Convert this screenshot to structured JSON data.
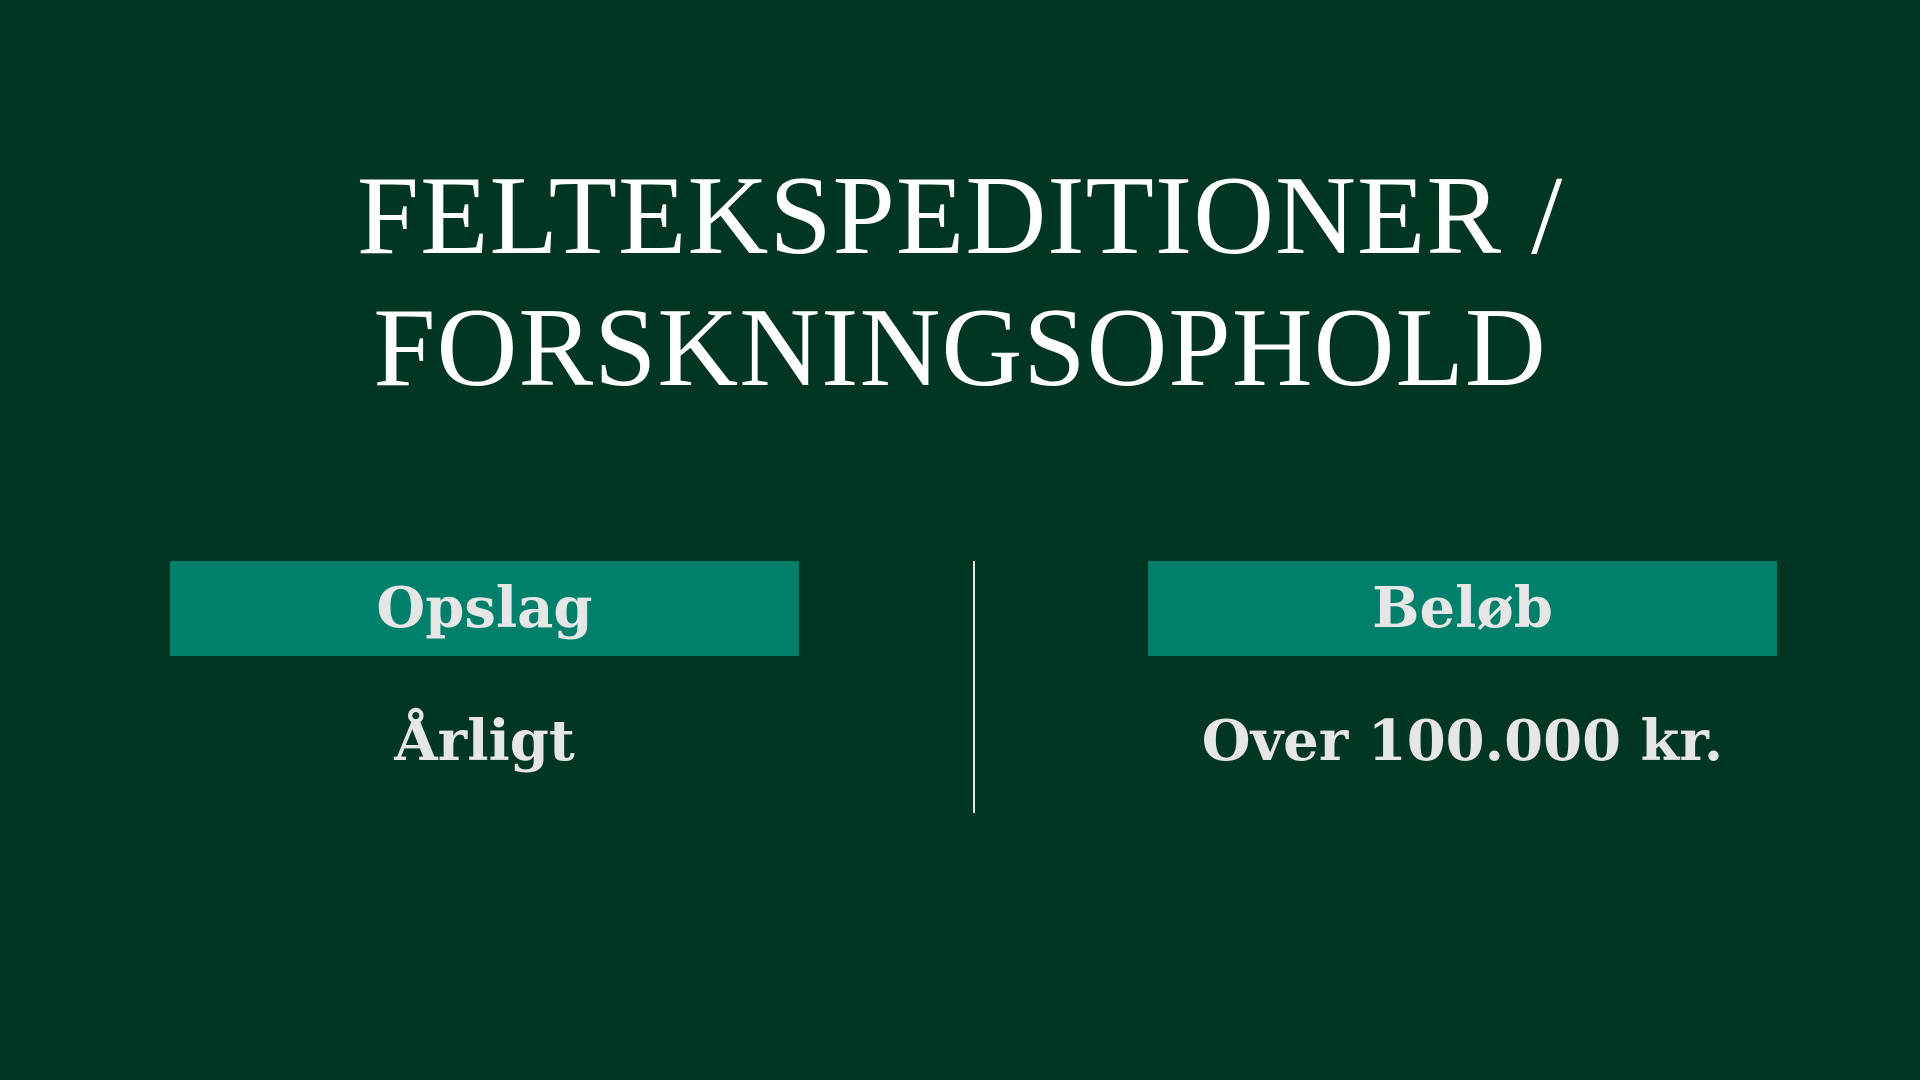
{
  "title": {
    "line1": "FELTEKSPEDITIONER /",
    "line2": "FORSKNINGSOPHOLD"
  },
  "left_column": {
    "header": "Opslag",
    "value": "Årligt"
  },
  "right_column": {
    "header": "Beløb",
    "value": "Over 100.000 kr."
  },
  "colors": {
    "background": "#013622",
    "header_bar": "#00806a",
    "text": "#e6e6e6",
    "title_text": "#ffffff"
  }
}
